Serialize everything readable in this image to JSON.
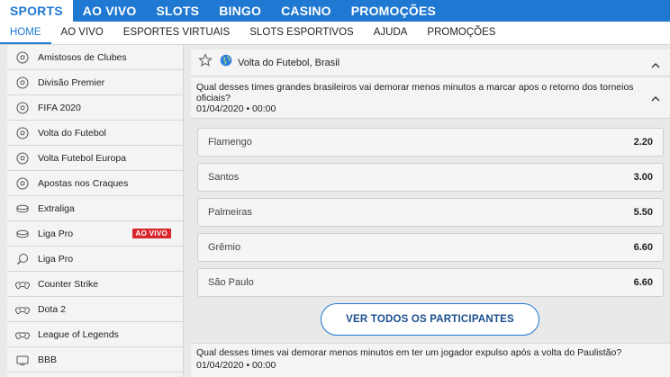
{
  "topnav": {
    "tabs": [
      {
        "label": "SPORTS"
      },
      {
        "label": "AO VIVO"
      },
      {
        "label": "SLOTS"
      },
      {
        "label": "BINGO"
      },
      {
        "label": "CASINO"
      },
      {
        "label": "PROMOÇÕES"
      }
    ]
  },
  "subnav": {
    "items": [
      {
        "label": "HOME"
      },
      {
        "label": "AO VIVO"
      },
      {
        "label": "ESPORTES VIRTUAIS"
      },
      {
        "label": "SLOTS ESPORTIVOS"
      },
      {
        "label": "AJUDA"
      },
      {
        "label": "PROMOÇÕES"
      }
    ]
  },
  "sidebar": {
    "items": [
      {
        "label": "Amistosos de Clubes",
        "icon": "soccer-ball-icon"
      },
      {
        "label": "Divisão Premier",
        "icon": "soccer-ball-icon"
      },
      {
        "label": "FIFA 2020",
        "icon": "soccer-ball-icon"
      },
      {
        "label": "Volta do Futebol",
        "icon": "soccer-ball-icon"
      },
      {
        "label": "Volta Futebol Europa",
        "icon": "soccer-ball-icon"
      },
      {
        "label": "Apostas nos Craques",
        "icon": "soccer-ball-icon"
      },
      {
        "label": "Extraliga",
        "icon": "puck-icon"
      },
      {
        "label": "Liga Pro",
        "icon": "puck-icon",
        "badge": "AO VIVO"
      },
      {
        "label": "Liga Pro",
        "icon": "ping-pong-icon"
      },
      {
        "label": "Counter Strike",
        "icon": "esports-icon"
      },
      {
        "label": "Dota 2",
        "icon": "esports-icon"
      },
      {
        "label": "League of Legends",
        "icon": "esports-icon"
      },
      {
        "label": "BBB",
        "icon": "tv-icon"
      }
    ]
  },
  "event": {
    "title": "Volta do Futebol, Brasil"
  },
  "market1": {
    "question": "Qual desses times grandes brasileiros vai demorar menos minutos a marcar apos o retorno dos torneios oficiais?",
    "date": "01/04/2020 • 00:00",
    "selections": [
      {
        "name": "Flamengo",
        "odds": "2.20"
      },
      {
        "name": "Santos",
        "odds": "3.00"
      },
      {
        "name": "Palmeiras",
        "odds": "5.50"
      },
      {
        "name": "Grêmio",
        "odds": "6.60"
      },
      {
        "name": "São Paulo",
        "odds": "6.60"
      }
    ],
    "see_all": "VER TODOS OS PARTICIPANTES"
  },
  "market2": {
    "question": "Qual desses times vai demorar menos minutos em ter um jogador expulso após a volta do Paulistão?",
    "date": "01/04/2020 • 00:00"
  }
}
